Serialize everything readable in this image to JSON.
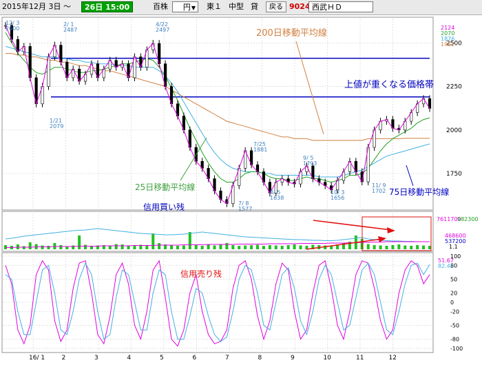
{
  "toolbar": {
    "period_start": "2015年12月 3日 ～",
    "period_end": "26日 15:00",
    "unit": "百株",
    "currency": "円",
    "market": "東１",
    "size": "中型",
    "margin": "貸",
    "back_label": "戻る",
    "code": "9024",
    "name": "西武ＨＤ"
  },
  "colors": {
    "price_line": "#000000",
    "ma25": "#e000e0",
    "ma75": "#20a020",
    "ma200": "#d08040",
    "ma_extra": "#40b0e0",
    "resistance": "#0000c0",
    "volume": "#20c020",
    "annotation_red": "#e01010"
  },
  "annotations": {
    "ma200": "200日移動平均線",
    "resistance": "上値が重くなる価格帯",
    "ma25": "25日移動平均線",
    "ma75": "75日移動平均線",
    "buy_margin": "信用買い残",
    "sell_margin": "信用売り残"
  },
  "legend_values": {
    "price": [
      "2124",
      "2070",
      "1876",
      "1952"
    ],
    "volume": [
      "7611700",
      "982300",
      "468600",
      "537200",
      "1.1"
    ],
    "oscillator": [
      "51.67",
      "82.42"
    ]
  },
  "chart_data": [
    {
      "type": "line",
      "name": "price",
      "x": [
        "12/3",
        "16/1",
        "2",
        "3",
        "4",
        "5",
        "6",
        "7",
        "8",
        "9",
        "10",
        "11",
        "12"
      ],
      "price_ylim": [
        1560,
        2620
      ],
      "y_ticks": [
        1750,
        2000,
        2250,
        2500
      ],
      "y_tick_labels": [
        "1750",
        "2000",
        "2250",
        "2500"
      ],
      "x_tick_labels": [
        "16/ 1",
        "2",
        "3",
        "4",
        "5",
        "6",
        "7",
        "8",
        "9",
        "10",
        "11",
        "12"
      ],
      "price_labels": [
        {
          "date": "12/ 3",
          "value": "2600"
        },
        {
          "date": "2/ 1",
          "value": "2487"
        },
        {
          "date": "1/21",
          "value": "2079"
        },
        {
          "date": "4/22",
          "value": "2497"
        },
        {
          "date": "7/25",
          "value": "1881"
        },
        {
          "date": "9/ 5",
          "value": "1793"
        },
        {
          "date": "8/ 5",
          "value": "1638"
        },
        {
          "date": "10/ 3",
          "value": "1656"
        },
        {
          "date": "7/ 8",
          "value": "1577"
        },
        {
          "date": "11/ 9",
          "value": "1702"
        }
      ],
      "resistance_levels": [
        2412,
        2190
      ],
      "close": [
        2600,
        2520,
        2450,
        2480,
        2300,
        2150,
        2250,
        2420,
        2487,
        2390,
        2300,
        2350,
        2280,
        2320,
        2380,
        2300,
        2350,
        2400,
        2360,
        2380,
        2300,
        2420,
        2360,
        2460,
        2497,
        2380,
        2250,
        2150,
        2080,
        2000,
        1900,
        1820,
        1780,
        1720,
        1650,
        1600,
        1577,
        1680,
        1780,
        1881,
        1800,
        1760,
        1700,
        1638,
        1700,
        1720,
        1700,
        1690,
        1760,
        1793,
        1720,
        1700,
        1680,
        1656,
        1710,
        1760,
        1820,
        1760,
        1702,
        1900,
        2000,
        2050,
        2060,
        2010,
        2000,
        2050,
        2100,
        2150,
        2180,
        2124
      ],
      "ma25": [
        2560,
        2500,
        2440,
        2400,
        2360,
        2330,
        2320,
        2340,
        2360,
        2360,
        2350,
        2340,
        2330,
        2330,
        2340,
        2340,
        2350,
        2360,
        2370,
        2380,
        2380,
        2390,
        2400,
        2410,
        2400,
        2360,
        2310,
        2240,
        2170,
        2090,
        2010,
        1940,
        1870,
        1810,
        1760,
        1720,
        1700,
        1700,
        1720,
        1750,
        1760,
        1760,
        1750,
        1730,
        1720,
        1720,
        1710,
        1710,
        1720,
        1730,
        1720,
        1720,
        1710,
        1700,
        1710,
        1720,
        1740,
        1740,
        1750,
        1780,
        1830,
        1880,
        1920,
        1950,
        1970,
        1990,
        2010,
        2040,
        2060,
        2070
      ],
      "ma75": [
        2480,
        2470,
        2460,
        2450,
        2440,
        2430,
        2420,
        2420,
        2420,
        2410,
        2410,
        2400,
        2400,
        2390,
        2390,
        2380,
        2380,
        2380,
        2370,
        2370,
        2370,
        2360,
        2360,
        2360,
        2360,
        2340,
        2310,
        2270,
        2220,
        2160,
        2100,
        2040,
        1980,
        1920,
        1870,
        1830,
        1800,
        1780,
        1770,
        1760,
        1760,
        1760,
        1750,
        1750,
        1740,
        1740,
        1740,
        1740,
        1740,
        1740,
        1740,
        1730,
        1730,
        1730,
        1730,
        1740,
        1750,
        1760,
        1770,
        1790,
        1810,
        1830,
        1850,
        1860,
        1870,
        1880,
        1890,
        1900,
        1910,
        1920
      ],
      "ma200": [
        2440,
        2440,
        2430,
        2430,
        2420,
        2420,
        2410,
        2400,
        2400,
        2390,
        2390,
        2380,
        2370,
        2370,
        2360,
        2350,
        2340,
        2340,
        2330,
        2320,
        2310,
        2300,
        2290,
        2280,
        2270,
        2260,
        2250,
        2230,
        2210,
        2190,
        2170,
        2150,
        2130,
        2110,
        2090,
        2070,
        2050,
        2040,
        2030,
        2020,
        2010,
        2000,
        1990,
        1980,
        1970,
        1960,
        1960,
        1950,
        1950,
        1950,
        1940,
        1940,
        1940,
        1940,
        1940,
        1940,
        1940,
        1940,
        1940,
        1950,
        1950,
        1950,
        1950,
        1950,
        1950,
        1952,
        1952,
        1952,
        1952,
        1952
      ]
    },
    {
      "type": "bar",
      "name": "volume",
      "ylim": [
        0,
        100
      ],
      "values": [
        12,
        10,
        14,
        9,
        20,
        15,
        11,
        10,
        18,
        12,
        9,
        11,
        40,
        13,
        10,
        11,
        12,
        9,
        15,
        14,
        11,
        10,
        13,
        12,
        46,
        18,
        14,
        12,
        10,
        11,
        50,
        12,
        10,
        13,
        11,
        14,
        18,
        12,
        10,
        11,
        12,
        13,
        10,
        12,
        11,
        10,
        12,
        14,
        11,
        10,
        13,
        12,
        11,
        10,
        14,
        18,
        22,
        40,
        30,
        15,
        12,
        11,
        10,
        12,
        14,
        11,
        10,
        12,
        11,
        10
      ],
      "buy_margin": [
        30,
        32,
        35,
        38,
        40,
        42,
        44,
        46,
        48,
        50,
        52,
        54,
        55,
        56,
        58,
        60,
        58,
        56,
        54,
        52,
        50,
        48,
        46,
        45,
        44,
        43,
        42,
        42,
        43,
        44,
        46,
        48,
        50,
        48,
        46,
        44,
        42,
        40,
        38,
        36,
        35,
        34,
        33,
        32,
        31,
        30,
        29,
        28,
        28,
        27,
        26,
        26,
        25,
        25,
        26,
        28,
        30,
        32,
        34,
        30,
        28,
        26,
        25,
        24,
        24,
        23,
        23,
        22,
        22,
        22
      ],
      "sell_margin": [
        5,
        5,
        6,
        6,
        6,
        7,
        7,
        7,
        8,
        8,
        8,
        8,
        9,
        9,
        9,
        9,
        10,
        10,
        10,
        10,
        10,
        11,
        11,
        11,
        11,
        12,
        12,
        12,
        12,
        13,
        13,
        13,
        13,
        14,
        14,
        14,
        14,
        14,
        15,
        15,
        15,
        15,
        15,
        16,
        16,
        16,
        16,
        16,
        17,
        17,
        17,
        17,
        17,
        18,
        18,
        18,
        19,
        19,
        20,
        20,
        21,
        21,
        22,
        22,
        22,
        22,
        22,
        22,
        22,
        22
      ]
    },
    {
      "type": "line",
      "name": "oscillator",
      "ylim": [
        -100,
        100
      ],
      "y_ticks": [
        100,
        80,
        50,
        20,
        0,
        -20,
        -50,
        -80,
        -100
      ],
      "y_tick_labels": [
        "100",
        "80",
        "50",
        "20",
        "0",
        "-20",
        "-50",
        "-80",
        "-100"
      ],
      "series": [
        {
          "values": [
            80,
            40,
            -60,
            -90,
            -50,
            60,
            90,
            70,
            -40,
            -85,
            -60,
            30,
            85,
            90,
            20,
            -70,
            -90,
            -30,
            60,
            85,
            40,
            -50,
            -80,
            -20,
            70,
            90,
            10,
            -80,
            -95,
            -60,
            20,
            60,
            -20,
            -70,
            -90,
            -85,
            -60,
            30,
            80,
            90,
            50,
            -30,
            -80,
            -40,
            40,
            85,
            70,
            -20,
            -80,
            -60,
            20,
            80,
            90,
            30,
            -50,
            -80,
            -20,
            60,
            90,
            85,
            30,
            -40,
            -80,
            -60,
            20,
            70,
            90,
            80,
            40,
            60
          ]
        },
        {
          "values": [
            60,
            50,
            -20,
            -70,
            -70,
            0,
            70,
            80,
            20,
            -60,
            -70,
            -20,
            50,
            85,
            60,
            -20,
            -80,
            -70,
            10,
            70,
            60,
            0,
            -60,
            -60,
            20,
            70,
            60,
            -20,
            -80,
            -80,
            -30,
            30,
            20,
            -30,
            -70,
            -85,
            -75,
            -20,
            50,
            80,
            70,
            20,
            -50,
            -60,
            0,
            60,
            75,
            30,
            -40,
            -70,
            -20,
            50,
            80,
            60,
            0,
            -60,
            -50,
            10,
            70,
            85,
            60,
            0,
            -60,
            -70,
            -20,
            40,
            80,
            85,
            60,
            82
          ]
        }
      ]
    }
  ]
}
